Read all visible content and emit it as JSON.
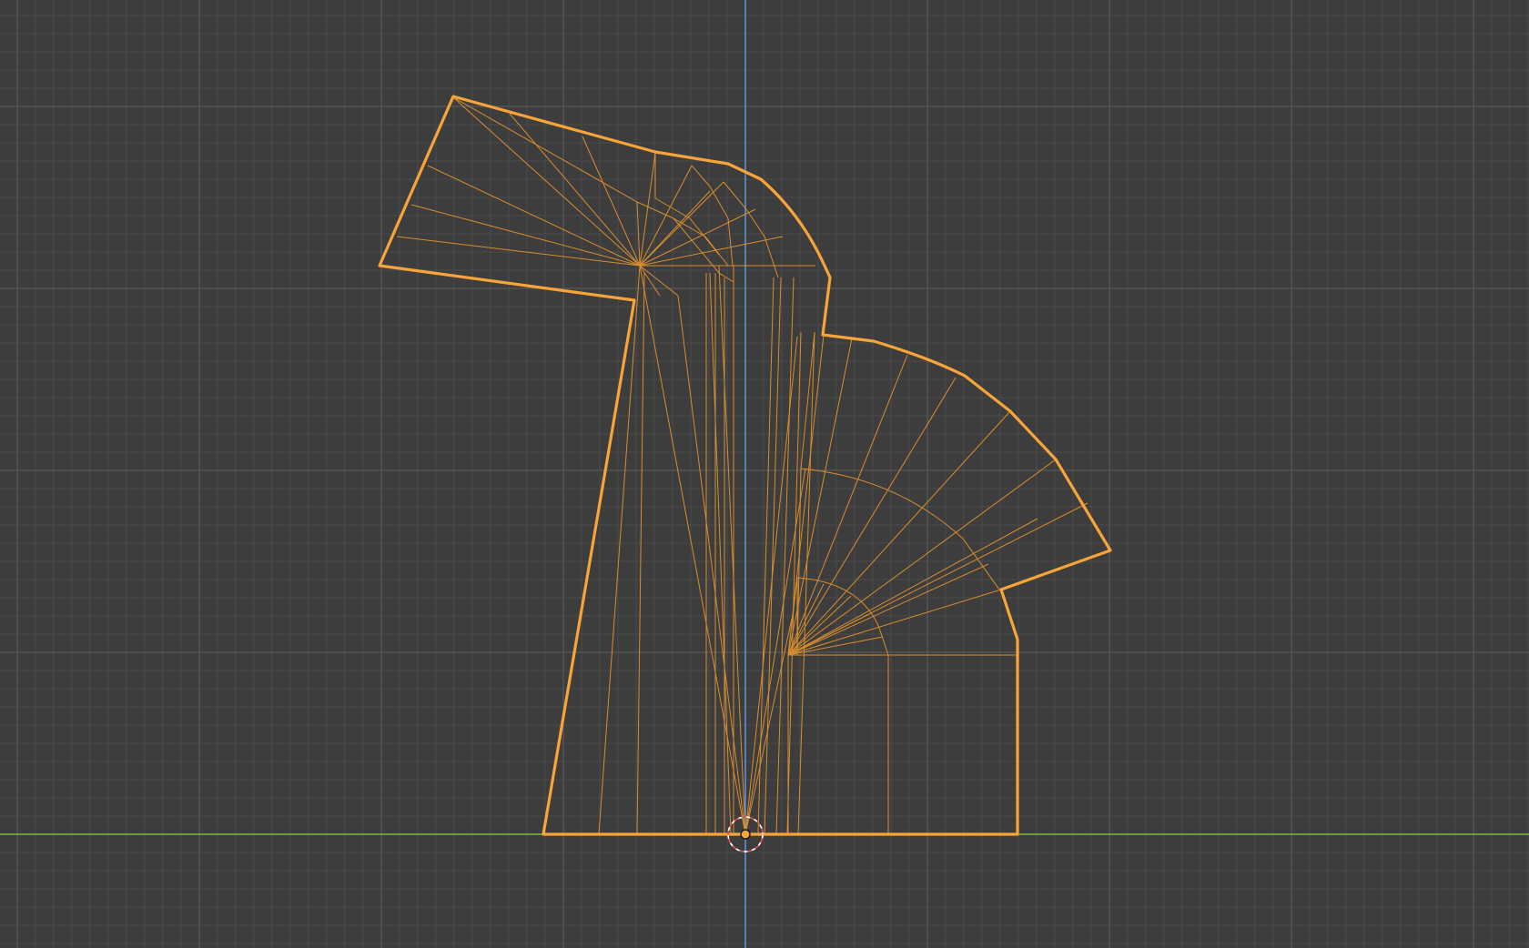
{
  "viewport": {
    "view": "orthographic-front",
    "mode": "wireframe",
    "object_selected": true
  },
  "colors": {
    "background": "#3d3d3d",
    "grid_minor": "#4a4a4a",
    "grid_major": "#555555",
    "axis_x": "#7fb33b",
    "axis_z": "#5b8fd6",
    "selection_outline": "#f7a43a",
    "wire": "#e0922f",
    "origin_dot": "#f7a43a",
    "cursor_ring_red": "#d9534f",
    "cursor_ring_white": "#ffffff"
  },
  "icons": {
    "cursor": "3d-cursor-icon",
    "origin": "object-origin-icon"
  }
}
